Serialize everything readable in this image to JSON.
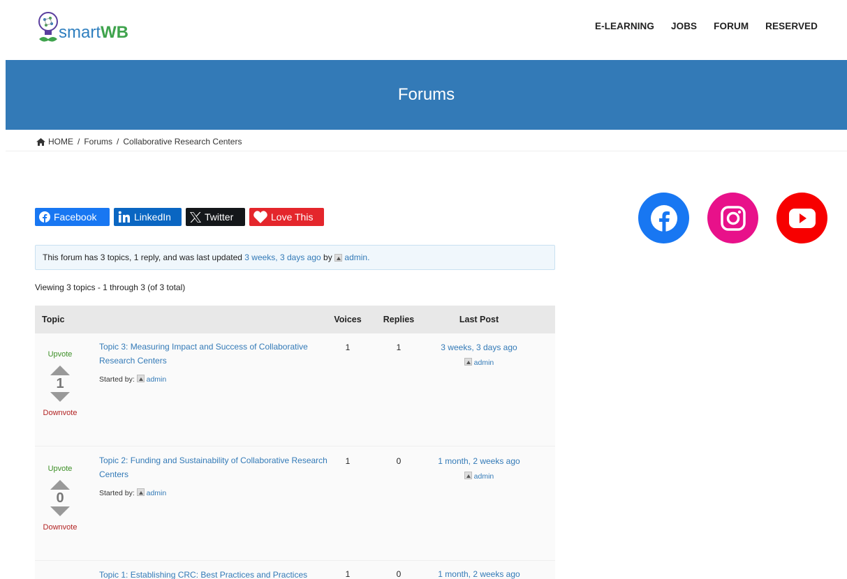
{
  "brand": {
    "name_part1": "smart",
    "name_part2": "WB"
  },
  "nav": {
    "items": [
      "E-LEARNING",
      "JOBS",
      "FORUM",
      "RESERVED"
    ]
  },
  "hero": {
    "title": "Forums"
  },
  "breadcrumb": {
    "home": "HOME",
    "forums": "Forums",
    "current": "Collaborative Research Centers",
    "sep": "/"
  },
  "share": {
    "facebook": "Facebook",
    "linkedin": "LinkedIn",
    "twitter": "Twitter",
    "love": "Love This"
  },
  "social": {
    "icons": [
      "facebook-icon",
      "instagram-icon",
      "youtube-icon"
    ]
  },
  "notice": {
    "prefix": "This forum has 3 topics, 1 reply, and was last updated",
    "when": "3 weeks, 3 days ago",
    "by": "by",
    "user": "admin."
  },
  "viewing": "Viewing 3 topics - 1 through 3 (of 3 total)",
  "table": {
    "headers": {
      "topic": "Topic",
      "voices": "Voices",
      "replies": "Replies",
      "last": "Last Post"
    },
    "upvote_label": "Upvote",
    "downvote_label": "Downvote",
    "started_label": "Started by:",
    "rows": [
      {
        "title": "Topic 3: Measuring Impact and Success of Collaborative Research Centers",
        "author": "admin",
        "votes": "1",
        "voices": "1",
        "replies": "1",
        "last": "3 weeks, 3 days ago",
        "last_by": "admin"
      },
      {
        "title": "Topic 2: Funding and Sustainability of Collaborative Research Centers",
        "author": "admin",
        "votes": "0",
        "voices": "1",
        "replies": "0",
        "last": "1 month, 2 weeks ago",
        "last_by": "admin"
      },
      {
        "title": "Topic 1: Establishing CRC: Best Practices and Practices",
        "voices": "1",
        "replies": "0",
        "last": "1 month, 2 weeks ago"
      }
    ]
  },
  "colors": {
    "hero": "#337ab7",
    "link": "#337ab7",
    "upvote": "#3c8f26",
    "downvote": "#b22222"
  }
}
